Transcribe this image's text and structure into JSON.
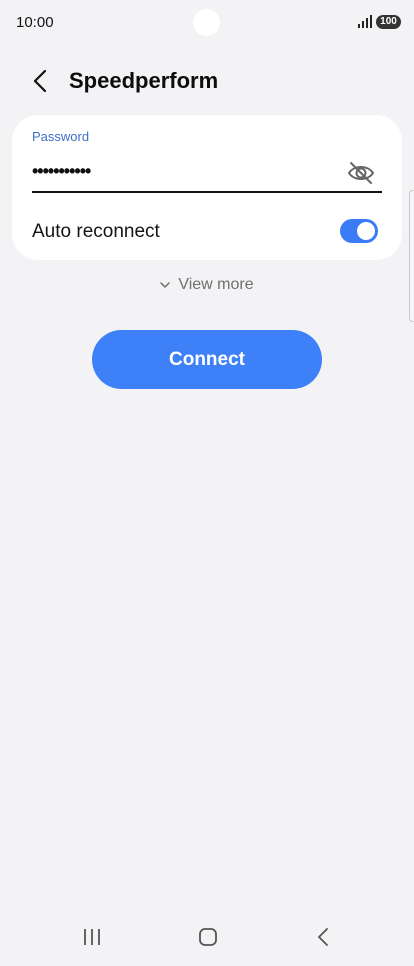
{
  "status_bar": {
    "time": "10:00",
    "battery": "100",
    "signal_icon": "signal-bars-icon"
  },
  "header": {
    "title": "Speedperform",
    "back_icon": "chevron-left-icon"
  },
  "form": {
    "password_label": "Password",
    "password_value": "•••••••••••",
    "visibility_icon": "eye-off-icon",
    "auto_reconnect_label": "Auto reconnect",
    "auto_reconnect_on": true
  },
  "view_more": {
    "label": "View more",
    "icon": "chevron-down-icon"
  },
  "connect_button": {
    "label": "Connect"
  },
  "nav": {
    "recents_icon": "recents-icon",
    "home_icon": "home-icon",
    "back_icon": "back-icon"
  },
  "colors": {
    "accent": "#3d80f8",
    "label_blue": "#3e6fc8",
    "background": "#f3f3f6",
    "card": "#ffffff"
  }
}
